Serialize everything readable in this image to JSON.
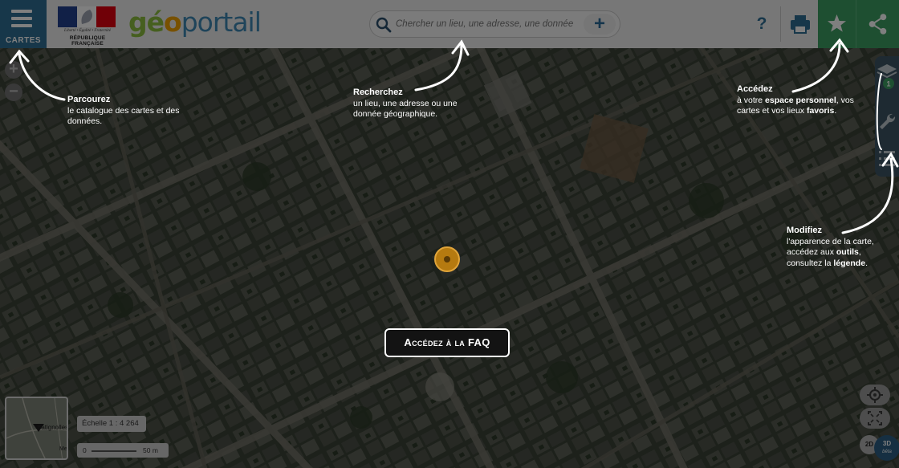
{
  "header": {
    "catalog_label": "CARTES",
    "rf_motto": "Liberté • Égalité • Fraternité",
    "rf_label": "RÉPUBLIQUE FRANÇAISE",
    "brand": {
      "part1": "gé",
      "part2": "o",
      "part3": "portail"
    },
    "search_placeholder": "Chercher un lieu, une adresse, une donnée",
    "add_label": "+",
    "help_label": "?"
  },
  "tips": {
    "catalog": {
      "title": "Parcourez",
      "text": "le catalogue des cartes et des données."
    },
    "search": {
      "title": "Recherchez",
      "text": "un lieu, une adresse ou une donnée géographique."
    },
    "personal": {
      "title": "Accédez",
      "t1": "à votre ",
      "b1": "espace personnel",
      "t2": ", vos cartes et vos lieux ",
      "b2": "favoris",
      "t3": "."
    },
    "modify": {
      "title": "Modifiez",
      "t1": "l'apparence de la carte, accédez aux ",
      "b1": "outils",
      "t2": ", consultez la ",
      "b2": "légende",
      "t3": "."
    }
  },
  "faq_label": "Accédez à la FAQ",
  "map": {
    "zoom_in": "+",
    "zoom_out": "−",
    "layers_badge": "1",
    "minimap_place": "Batignolles",
    "minimap_place2": "Me",
    "scale_text": "Échelle 1 : 4 264",
    "scale_start": "0",
    "scale_end": "50 m",
    "btn_2d": "2D",
    "btn_3d": "3D",
    "btn_3d_beta": "bêta"
  },
  "colors": {
    "primary_blue": "#2f6f94",
    "accent_green": "#3d9e62",
    "brand_green": "#8cbf3f",
    "brand_orange": "#f0a200",
    "brand_blue": "#3e88b5"
  }
}
